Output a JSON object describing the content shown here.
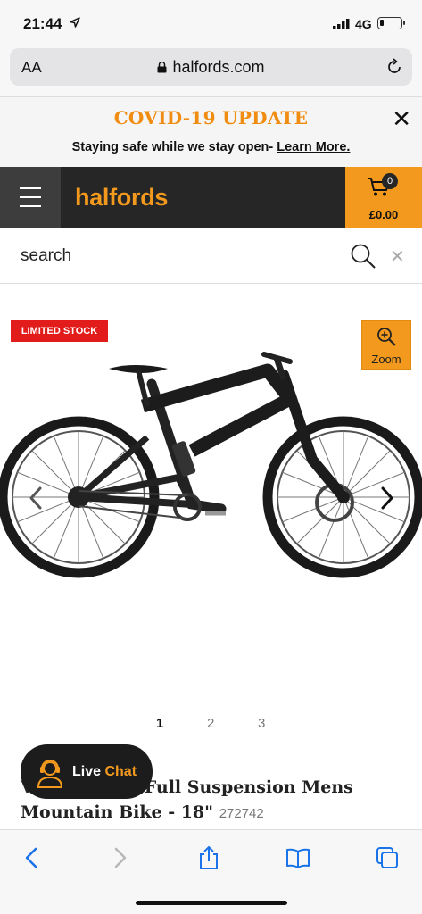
{
  "status_bar": {
    "time": "21:44",
    "network": "4G",
    "battery_level": 0.15
  },
  "browser": {
    "text_size_button": "AA",
    "url": "halfords.com"
  },
  "covid_banner": {
    "title": "COVID-19 UPDATE",
    "message": "Staying safe while we stay open-",
    "link_text": "Learn More."
  },
  "header": {
    "logo": "halfords",
    "basket_count": "0",
    "basket_total": "£0.00"
  },
  "search": {
    "placeholder": "search"
  },
  "product": {
    "stock_badge": "LIMITED STOCK",
    "zoom_label": "Zoom",
    "title": "Voodoo Canzo Full Suspension Mens Mountain Bike - 18\"",
    "title_visible_start": "V",
    "title_visible_rest": "Full Suspension Mens Mountain Bike - 18\"",
    "code": "272742",
    "pages": [
      "1",
      "2",
      "3"
    ],
    "active_page": "1"
  },
  "live_chat": {
    "label_1": "Live",
    "label_2": "Chat"
  },
  "colors": {
    "brand_orange": "#f39a1e",
    "header_dark": "#262626",
    "badge_red": "#e21b1b",
    "ios_blue": "#1a73e8"
  },
  "icons": {
    "location": "location-arrow-icon",
    "lock": "lock-icon",
    "reload": "reload-icon",
    "close": "close-icon",
    "menu": "hamburger-menu-icon",
    "basket": "basket-icon",
    "search": "search-icon",
    "zoom": "zoom-in-icon",
    "prev": "chevron-left-icon",
    "next": "chevron-right-icon",
    "chat": "headset-agent-icon",
    "back": "back-arrow-icon",
    "forward": "forward-arrow-icon",
    "share": "share-icon",
    "bookmarks": "bookmarks-icon",
    "tabs": "tabs-icon"
  }
}
